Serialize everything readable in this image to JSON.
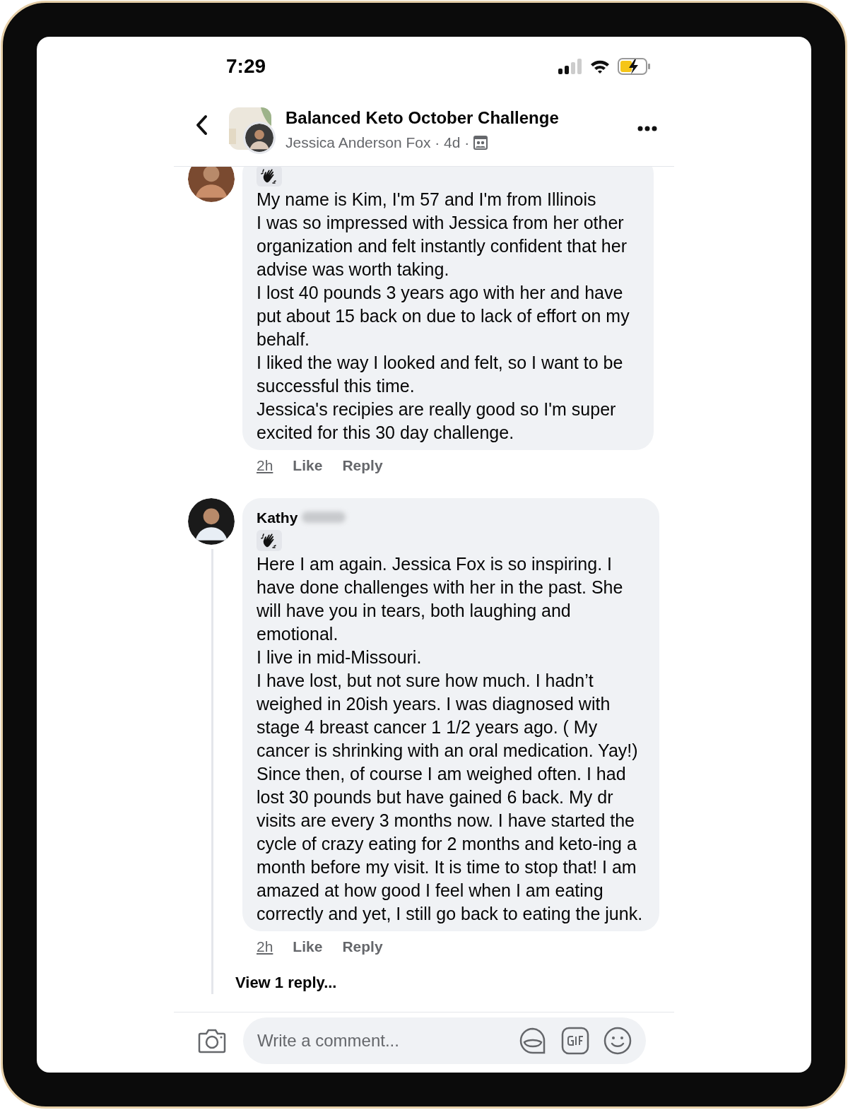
{
  "status_bar": {
    "time": "7:29"
  },
  "header": {
    "title": "Balanced Keto October Challenge",
    "subtitle": "Jessica Anderson Fox · 4d ·"
  },
  "comments": [
    {
      "clipped": true,
      "paragraphs": [
        "My name is Kim, I'm 57 and I'm from Illinois",
        "I was so impressed with Jessica from her other organization and felt instantly confident that her advise was worth taking.",
        "I lost 40 pounds 3 years ago with her and have put about 15 back on due to lack of effort on my behalf.",
        "I liked the way I looked and felt, so I want to be successful this time.",
        "Jessica's recipies are really good so I'm super excited for this 30 day challenge."
      ],
      "time": "2h",
      "like": "Like",
      "reply": "Reply"
    },
    {
      "clipped": false,
      "author": "Kathy",
      "author_blurred": true,
      "paragraphs": [
        "Here I am again. Jessica Fox is so inspiring. I have done challenges with her in the past. She will have you in tears, both laughing and emotional.",
        "I live in mid-Missouri.",
        "I have lost, but not sure how much. I hadn’t weighed in 20ish years. I was diagnosed with stage 4 breast cancer 1 1/2 years ago. ( My cancer is shrinking with an oral medication. Yay!) Since then, of course I am weighed often. I had lost 30 pounds but have gained 6 back. My dr visits are every 3 months now. I have started the cycle of crazy eating for 2 months and keto-ing a month before my visit. It is time to stop that! I am amazed at how good I feel when I am eating correctly and yet, I still go back to eating the junk."
      ],
      "time": "2h",
      "like": "Like",
      "reply": "Reply",
      "view_replies": "View 1 reply..."
    }
  ],
  "composer": {
    "placeholder": "Write a comment..."
  }
}
